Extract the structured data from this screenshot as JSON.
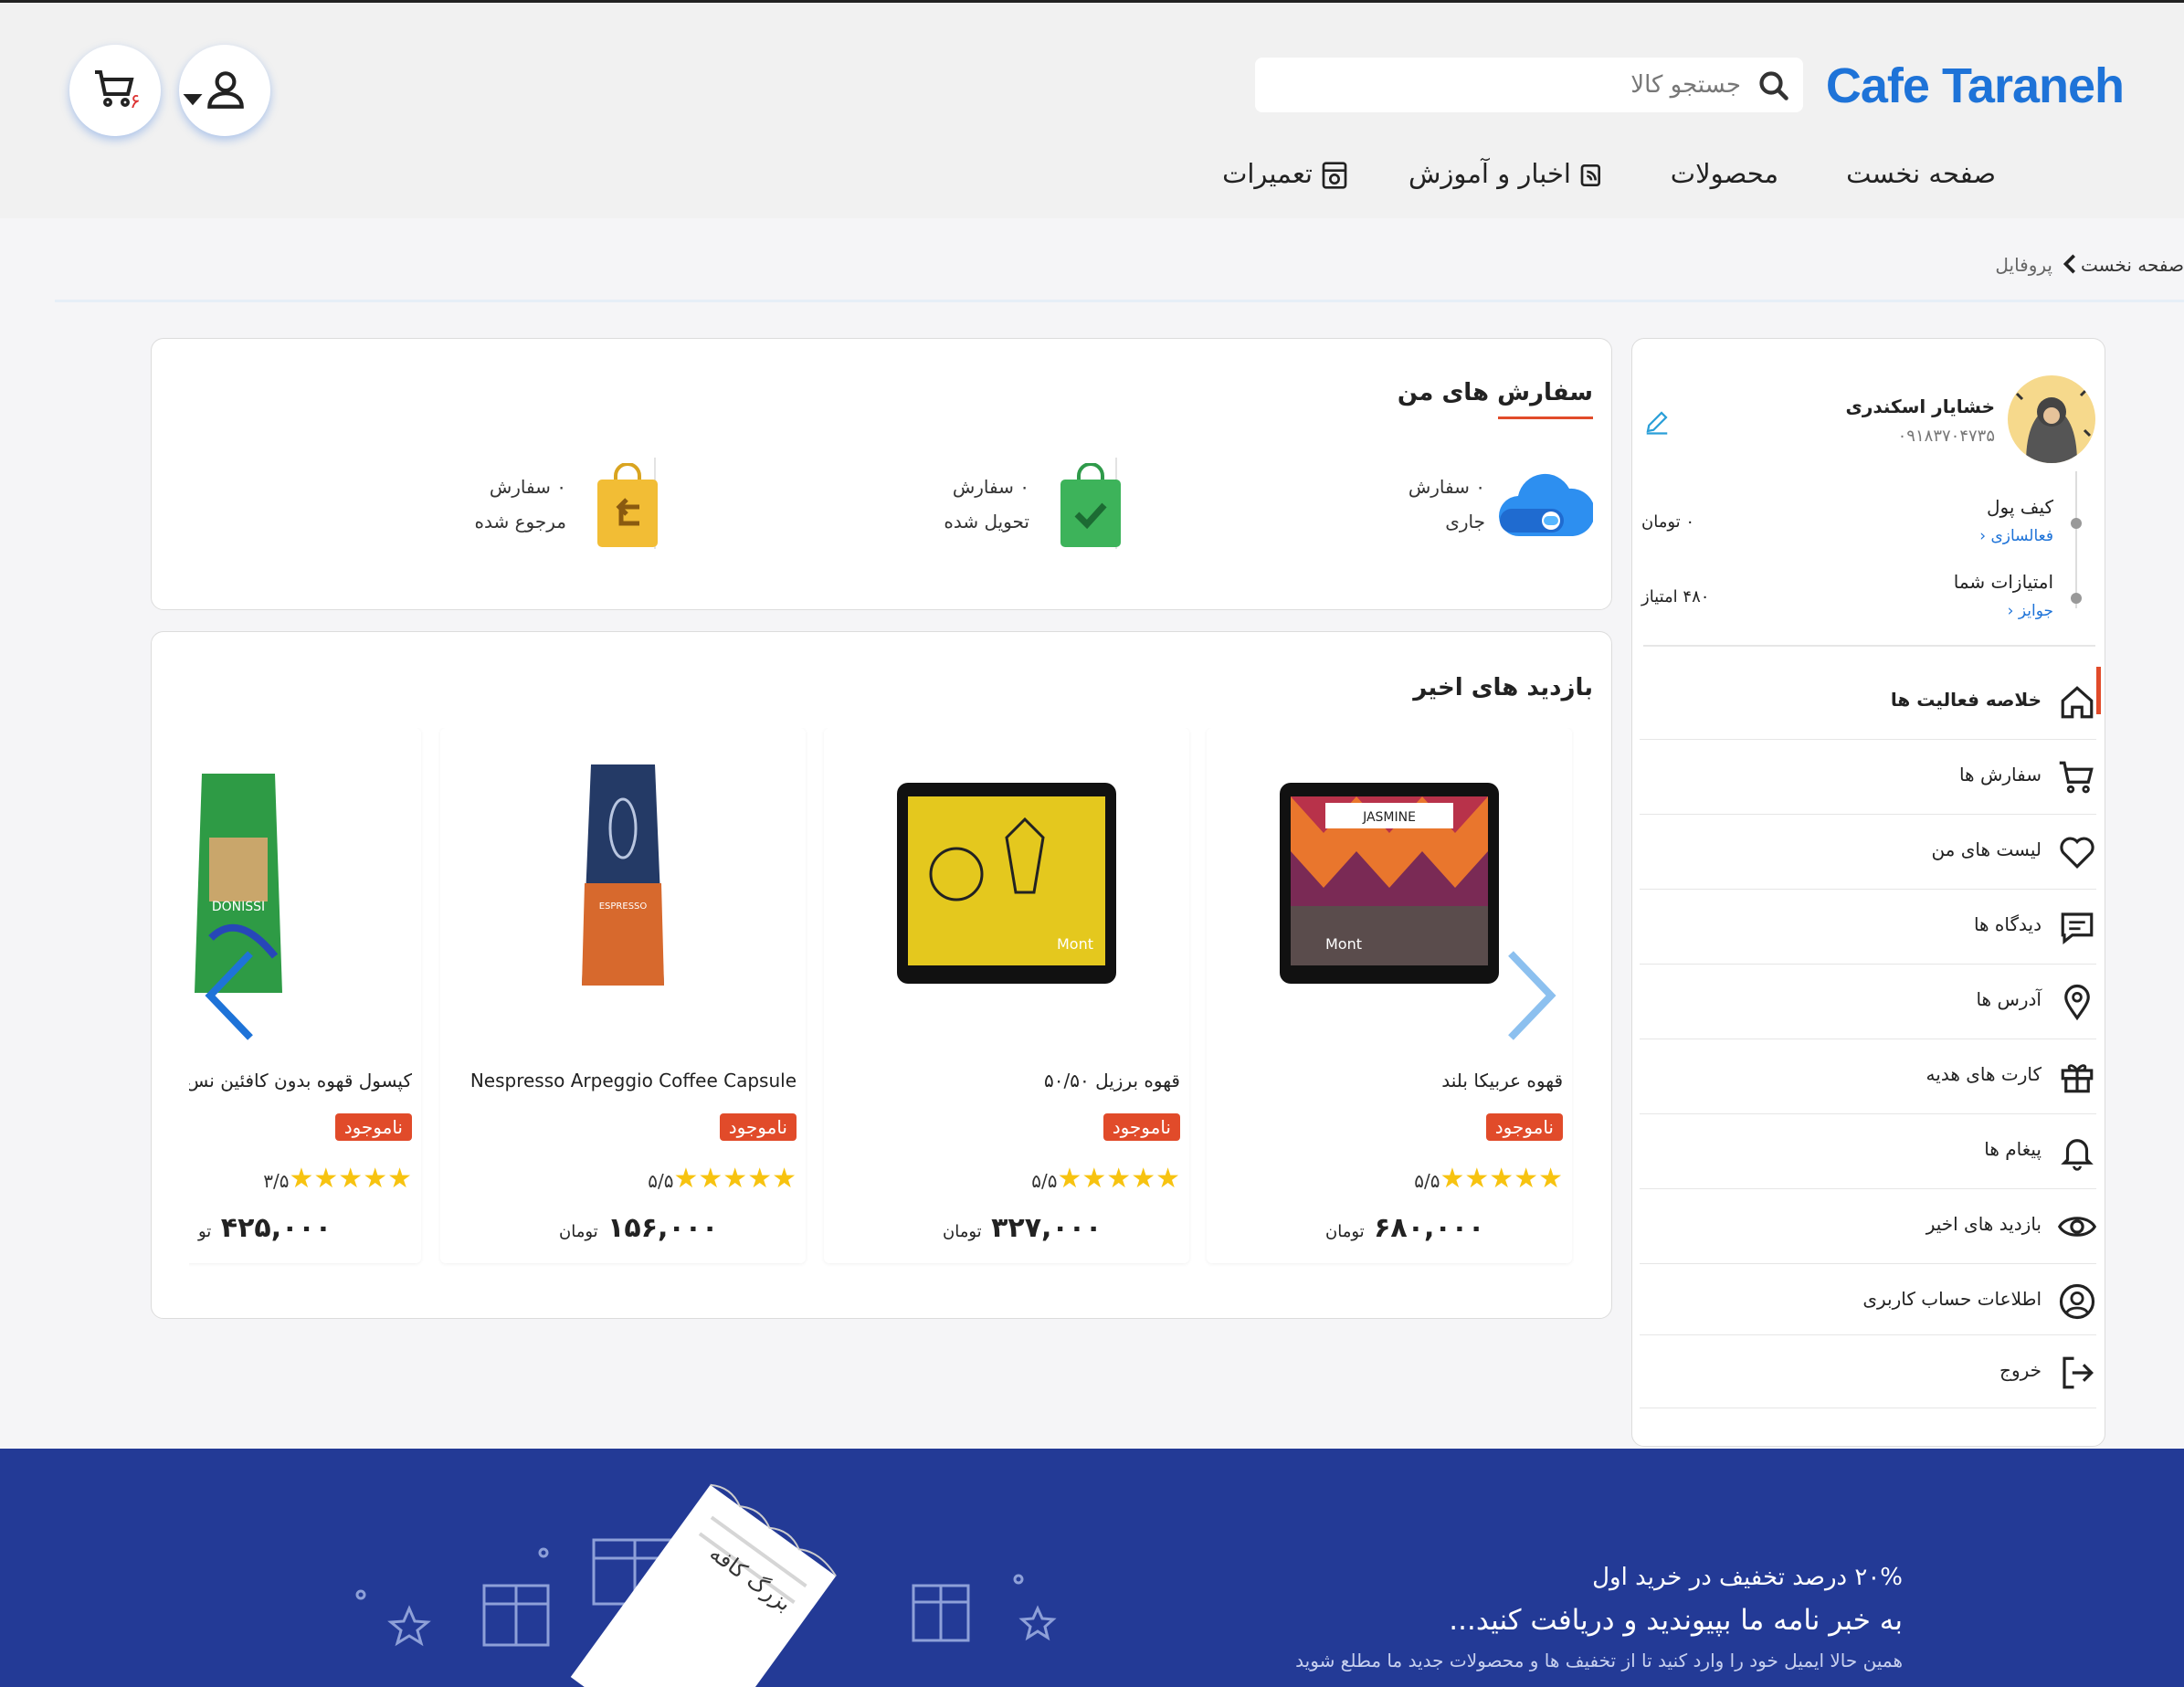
{
  "header": {
    "logo": "Cafe Taraneh",
    "search_placeholder": "جستجو کالا",
    "cart_count": "۶",
    "nav": {
      "home": "صفحه نخست",
      "products": "محصولات",
      "news": "اخبار و آموزش",
      "repairs": "تعمیرات"
    }
  },
  "breadcrumb": {
    "home": "صفحه نخست",
    "current": "پروفایل"
  },
  "profile": {
    "name": "خشایار اسکندری",
    "phone": "۰۹۱۸۳۷۰۴۷۳۵",
    "wallet_label": "کیف پول",
    "wallet_action": "فعالسازی",
    "wallet_value": "۰ تومان",
    "points_label": "امتیازات شما",
    "points_action": "جوایز",
    "points_value": "۴۸۰ امتیاز"
  },
  "sidebar": {
    "items": [
      {
        "label": "خلاصه فعالیت ها",
        "icon": "home-icon"
      },
      {
        "label": "سفارش ها",
        "icon": "cart-icon"
      },
      {
        "label": "لیست های من",
        "icon": "heart-icon"
      },
      {
        "label": "دیدگاه ها",
        "icon": "comment-icon"
      },
      {
        "label": "آدرس ها",
        "icon": "location-icon"
      },
      {
        "label": "کارت های هدیه",
        "icon": "gift-icon"
      },
      {
        "label": "پیغام ها",
        "icon": "bell-icon"
      },
      {
        "label": "بازدید های اخیر",
        "icon": "eye-icon"
      },
      {
        "label": "اطلاعات حساب کاربری",
        "icon": "user-circle-icon"
      },
      {
        "label": "خروج",
        "icon": "logout-icon"
      }
    ]
  },
  "orders": {
    "title": "سفارش های من",
    "current_count": "۰ سفارش",
    "current_label": "جاری",
    "delivered_count": "۰ سفارش",
    "delivered_label": "تحویل شده",
    "returned_count": "۰ سفارش",
    "returned_label": "مرجوع شده"
  },
  "recent": {
    "title": "بازدید های اخیر",
    "products": [
      {
        "name": "قهوه عربیکا بلند",
        "badge": "ناموجود",
        "rating": "۵/۵",
        "stars": "★★★★★",
        "price": "۶۸۰,۰۰۰",
        "currency": "تومان",
        "image": "jasmine-coffee-bag"
      },
      {
        "name": "قهوه برزیل ۵۰/۵۰",
        "badge": "ناموجود",
        "rating": "۵/۵",
        "stars": "★★★★★",
        "price": "۳۲۷,۰۰۰",
        "currency": "تومان",
        "image": "brazil-coffee-bag"
      },
      {
        "name": "Nespresso Arpeggio Coffee Capsule",
        "badge": "ناموجود",
        "rating": "۵/۵",
        "stars": "★★★★★",
        "price": "۱۵۶,۰۰۰",
        "currency": "تومان",
        "image": "espresso-bag"
      },
      {
        "name": "کپسول قهوه بدون کافئین نس",
        "badge": "ناموجود",
        "rating": "۳/۵",
        "stars": "★★★★★",
        "price": "۴۲۵,۰۰۰",
        "currency": "تو",
        "image": "donissi-bag"
      }
    ]
  },
  "footer": {
    "line1": "۲۰% درصد تخفیف در خرید اول",
    "line2": "به خبر نامه ما بپیوندید و دریافت کنید...",
    "line3": "همین حالا ایمیل خود را وارد کنید تا از تخفیف ها و محصولات جدید ما مطلع شوید",
    "coupon_text": "بزرگ کافه"
  },
  "colors": {
    "brand": "#1e73d8",
    "accent": "#e14b2a",
    "footer": "#233a96",
    "star": "#f7c310"
  }
}
